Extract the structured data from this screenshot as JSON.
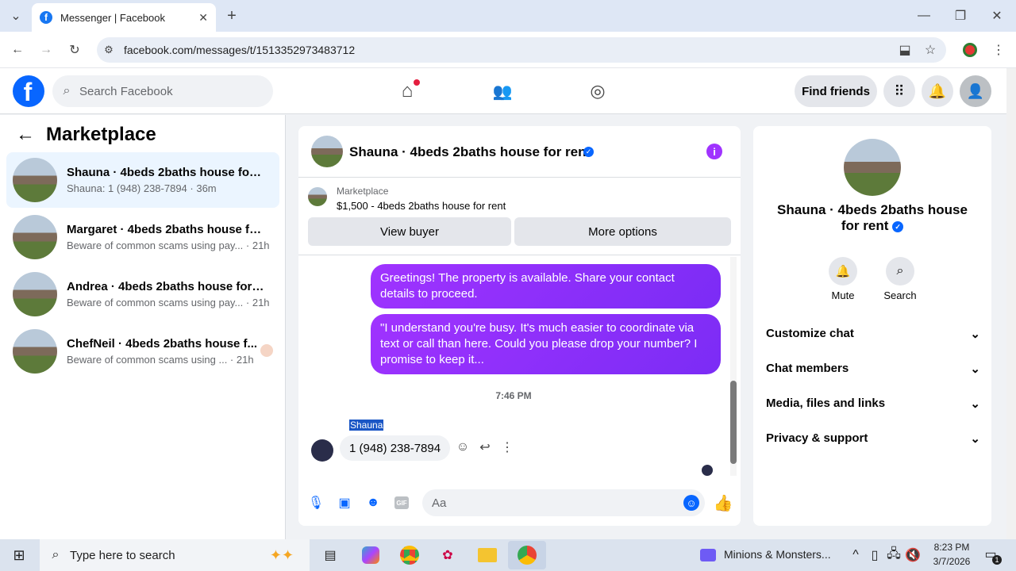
{
  "browser": {
    "tab_title": "Messenger | Facebook",
    "url": "facebook.com/messages/t/1513352973483712",
    "icons": [
      "tab-list-icon",
      "close-tab-icon",
      "new-tab-icon",
      "minimize-icon",
      "restore-icon",
      "close-window-icon",
      "back-icon",
      "forward-icon",
      "reload-icon",
      "site-info-icon",
      "install-icon",
      "bookmark-star-icon",
      "profile-icon",
      "menu-icon"
    ]
  },
  "fb_header": {
    "logo": "f",
    "search_placeholder": "Search Facebook",
    "find_friends": "Find friends"
  },
  "sidebar": {
    "title": "Marketplace",
    "conversations": [
      {
        "name": "Shauna · 4beds 2baths house for r...",
        "preview": "Shauna: 1 (948) 238-7894 · 36m"
      },
      {
        "name": "Margaret · 4beds 2baths house for...",
        "preview": "Beware of common scams using pay... · 21h"
      },
      {
        "name": "Andrea · 4beds 2baths house for r...",
        "preview": "Beware of common scams using pay... · 21h"
      },
      {
        "name": "ChefNeil · 4beds 2baths house f...",
        "preview": "Beware of common scams using ... · 21h"
      }
    ]
  },
  "chat": {
    "header_title": "Shauna · 4beds 2baths house for rent",
    "listing_source": "Marketplace",
    "listing_title": "$1,500 - 4beds 2baths house for rent",
    "view_buyer": "View buyer",
    "more_options": "More options",
    "messages_out": [
      "Greetings! The property is available. Share your contact details to proceed.",
      "\"I understand you're busy. It's much easier to coordinate via text or call than here. Could you please drop your number? I promise to keep it..."
    ],
    "timestamp": "7:46 PM",
    "sender_name": "Shauna",
    "incoming_message": "1 (948) 238-7894",
    "composer_placeholder": "Aa"
  },
  "details": {
    "title": "Shauna · 4beds 2baths house for rent",
    "mute": "Mute",
    "search": "Search",
    "sections": [
      "Customize chat",
      "Chat members",
      "Media, files and links",
      "Privacy & support"
    ]
  },
  "taskbar": {
    "search_placeholder": "Type here to search",
    "media": "Minions & Monsters...",
    "time": "8:23 PM",
    "date": "3/7/2026",
    "notif_count": "1"
  },
  "colors": {
    "fb_blue": "#0866ff",
    "bubble_purple": "#8a2be2",
    "verified": "#0866ff",
    "active_convo": "#ebf5ff"
  }
}
